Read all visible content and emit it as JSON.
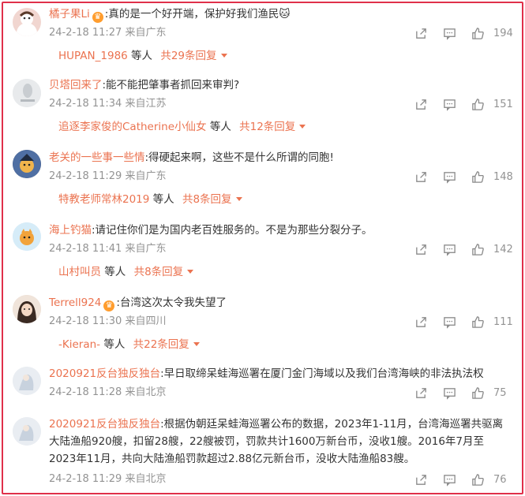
{
  "comments": [
    {
      "user": "橘子果Li",
      "vip": true,
      "text": ":真的是一个好开端，保护好我们渔民",
      "emoji": "🐱",
      "meta": "24-2-18 11:27 来自广东",
      "likes": "194",
      "reply_user": "HUPAN_1986",
      "reply_mid": "等人",
      "reply_count": "共29条回复"
    },
    {
      "user": "贝塔回来了",
      "vip": false,
      "text": ":能不能把肇事者抓回来审判?",
      "meta": "24-2-18 11:34 来自江苏",
      "likes": "151",
      "reply_user": "追逐李家俊的Catherine小仙女",
      "reply_mid": "等人",
      "reply_count": "共12条回复"
    },
    {
      "user": "老关的一些事一些情",
      "vip": false,
      "text": ":得硬起来啊，这些不是什么所谓的同胞!",
      "meta": "24-2-18 11:29 来自广东",
      "likes": "148",
      "reply_user": "特教老师常林2019",
      "reply_mid": "等人",
      "reply_count": "共8条回复"
    },
    {
      "user": "海上钓猫",
      "vip": false,
      "text": ":请记住你们是为国内老百姓服务的。不是为那些分裂分子。",
      "meta": "24-2-18 11:41 来自广东",
      "likes": "142",
      "reply_user": "山村叫员",
      "reply_mid": "等人",
      "reply_count": "共8条回复"
    },
    {
      "user": "Terrell924",
      "vip": true,
      "text": ":台湾这次太令我失望了",
      "meta": "24-2-18 11:30 来自四川",
      "likes": "111",
      "reply_user": "-Kieran-",
      "reply_mid": "等人",
      "reply_count": "共22条回复"
    },
    {
      "user": "2020921反台独反独台",
      "vip": false,
      "text": ":早日取缔呆蛙海巡署在厦门金门海域以及我们台湾海峡的非法执法权",
      "meta": "24-2-18 11:28 来自北京",
      "likes": "75"
    },
    {
      "user": "2020921反台独反独台",
      "vip": false,
      "text": ":根据伪朝廷呆蛙海巡署公布的数据，2023年1-11月，台湾海巡署共驱离大陆渔船920艘，扣留28艘，22艘被罚，罚款共计1600万新台币，没收1艘。2016年7月至2023年11月，共向大陆渔船罚款超过2.88亿元新台币，没收大陆渔船83艘。",
      "meta": "24-2-18 11:29 来自北京",
      "likes": "76"
    }
  ],
  "icons": {
    "share": "share-icon",
    "comment": "comment-icon",
    "like": "thumbs-up-icon",
    "vip": "vip-crown-icon"
  },
  "colors": {
    "accent": "#eb7350",
    "border": "#e0304a",
    "meta": "#939393",
    "text": "#333333"
  }
}
